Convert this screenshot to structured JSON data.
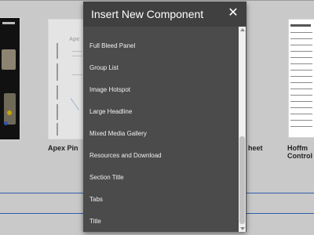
{
  "modal": {
    "title": "Insert New Component",
    "close_glyph": "✕",
    "items": [
      "Full Bleed Panel",
      "Group List",
      "Image Hotspot",
      "Large Headline",
      "Mixed Media Gallery",
      "Resources and Download",
      "Section Title",
      "Tabs",
      "Title"
    ]
  },
  "background": {
    "card_titles": {
      "apex": "Apex Pin",
      "sheet": "heet",
      "hoffman_line1": "Hoffm",
      "hoffman_line2": "Control"
    }
  },
  "colors": {
    "page_bg": "#c9c9c9",
    "modal_bg": "#4b4b4b",
    "modal_header": "#404040",
    "divider_line": "#2f5ea8"
  },
  "icons": {
    "close": "close-icon",
    "scroll_up": "chevron-up-icon",
    "scroll_down": "chevron-down-icon"
  }
}
